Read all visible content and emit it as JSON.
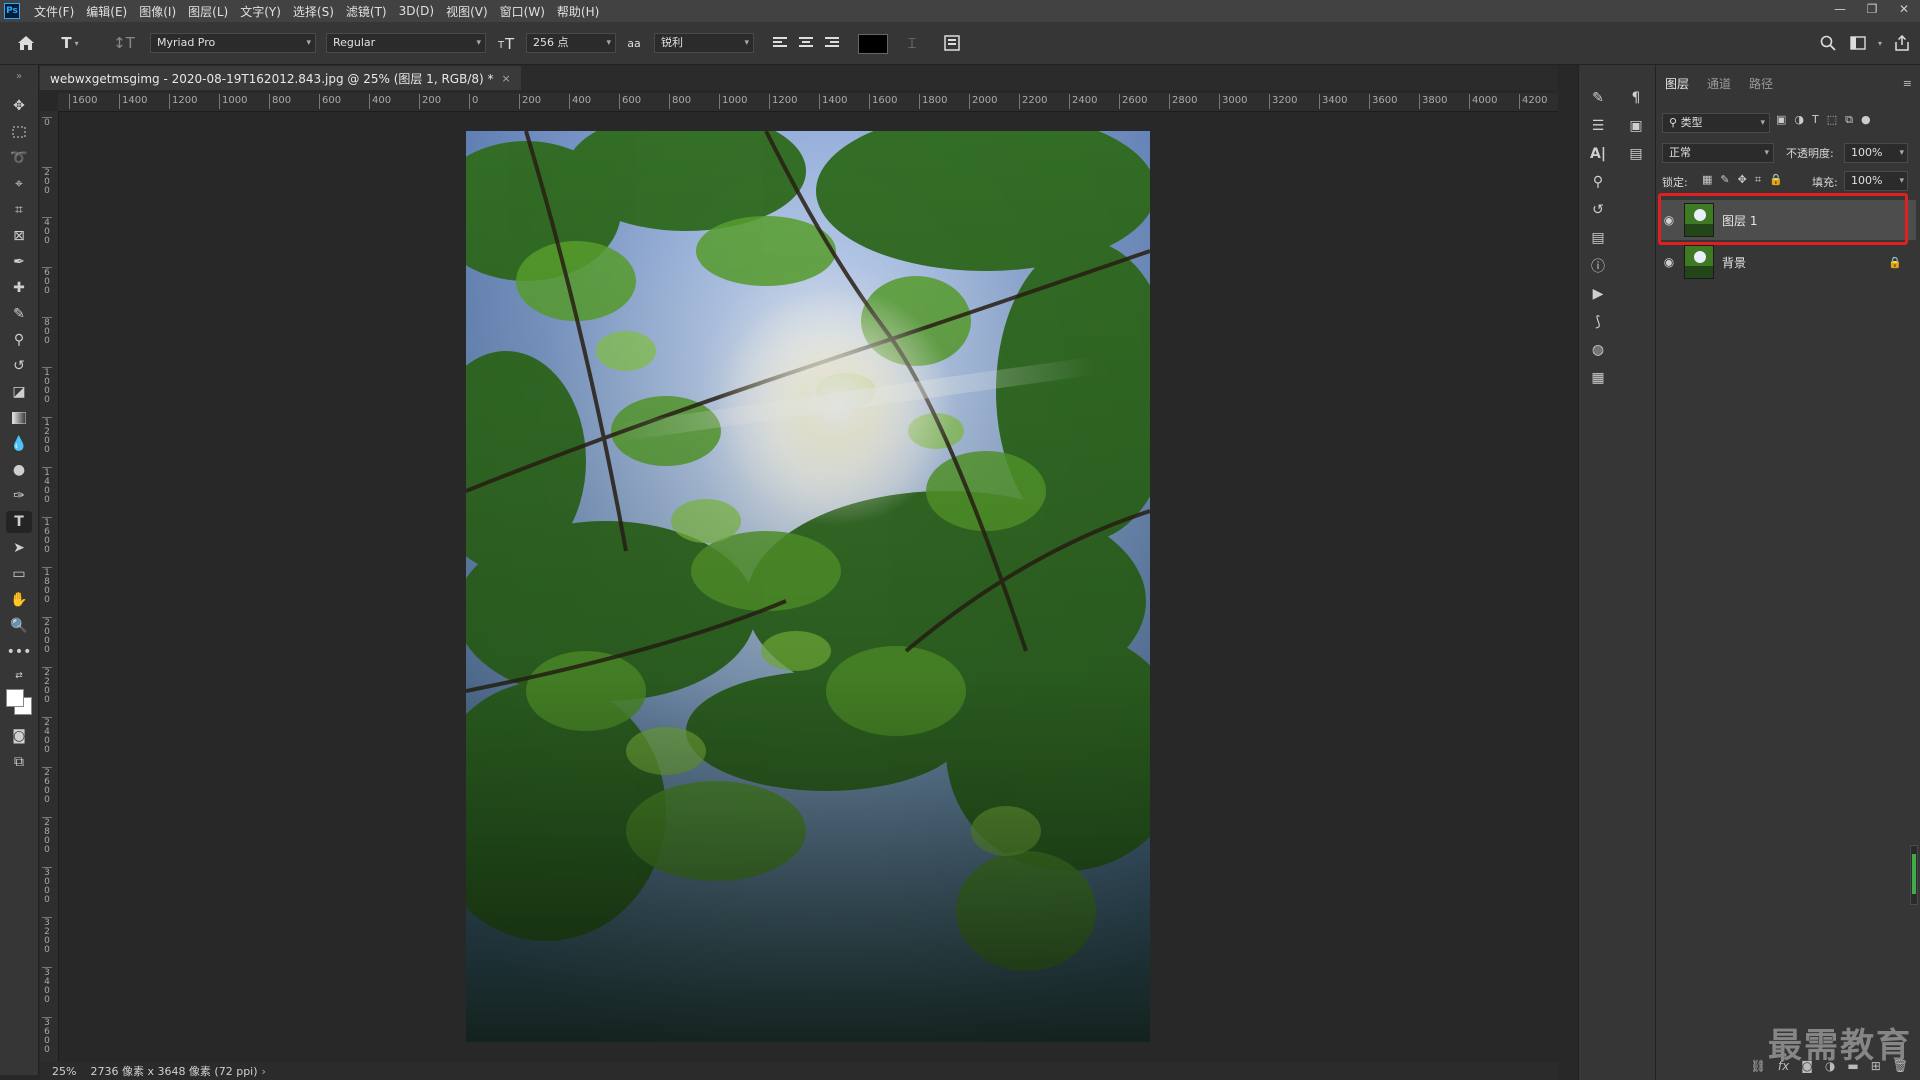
{
  "menubar": {
    "logo": "Ps",
    "items": [
      "文件(F)",
      "编辑(E)",
      "图像(I)",
      "图层(L)",
      "文字(Y)",
      "选择(S)",
      "滤镜(T)",
      "3D(D)",
      "视图(V)",
      "窗口(W)",
      "帮助(H)"
    ],
    "window_controls": [
      "—",
      "❐",
      "✕"
    ]
  },
  "options_bar": {
    "font_family": "Myriad Pro",
    "font_style": "Regular",
    "font_size": "256 点",
    "anti_alias": "锐利",
    "color_swatch": "#000000"
  },
  "document": {
    "tab_title": "webwxgetmsgimg - 2020-08-19T162012.843.jpg @ 25% (图层 1, RGB/8) *",
    "close": "×"
  },
  "ruler": {
    "h_labels": [
      "1600",
      "1400",
      "1200",
      "1000",
      "800",
      "600",
      "400",
      "200",
      "0",
      "200",
      "400",
      "600",
      "800",
      "1000",
      "1200",
      "1400",
      "1600",
      "1800",
      "2000",
      "2200",
      "2400",
      "2600",
      "2800",
      "3000",
      "3200",
      "3400",
      "3600",
      "3800",
      "4000",
      "4200"
    ],
    "v_labels": [
      "0",
      "2\n0\n0",
      "4\n0\n0",
      "6\n0\n0",
      "8\n0\n0",
      "1\n0\n0\n0",
      "1\n2\n0\n0",
      "1\n4\n0\n0",
      "1\n6\n0\n0",
      "1\n8\n0\n0",
      "2\n0\n0\n0",
      "2\n2\n0\n0",
      "2\n4\n0\n0",
      "2\n6\n0\n0",
      "2\n8\n0\n0",
      "3\n0\n0\n0",
      "3\n2\n0\n0",
      "3\n4\n0\n0",
      "3\n6\n0\n0"
    ]
  },
  "status": {
    "zoom": "25%",
    "info": "2736 像素 x 3648 像素 (72 ppi)",
    "arrow": "›"
  },
  "layers_panel": {
    "tabs": [
      "图层",
      "通道",
      "路径"
    ],
    "filter_kind": "类型",
    "blend_mode": "正常",
    "opacity_label": "不透明度:",
    "opacity_value": "100%",
    "lock_label": "锁定:",
    "fill_label": "填充:",
    "fill_value": "100%",
    "layers": [
      {
        "name": "图层 1",
        "selected": true
      },
      {
        "name": "背景",
        "locked": true
      }
    ],
    "bottom_icons": [
      "link-icon",
      "fx-icon",
      "mask-icon",
      "adjustment-icon",
      "folder-icon",
      "new-layer-icon",
      "trash-icon"
    ],
    "bottom_fx": "fx"
  },
  "watermark": "最需教育",
  "colors": {
    "selection_outline": "#e02020",
    "accent": "#31a8ff"
  }
}
